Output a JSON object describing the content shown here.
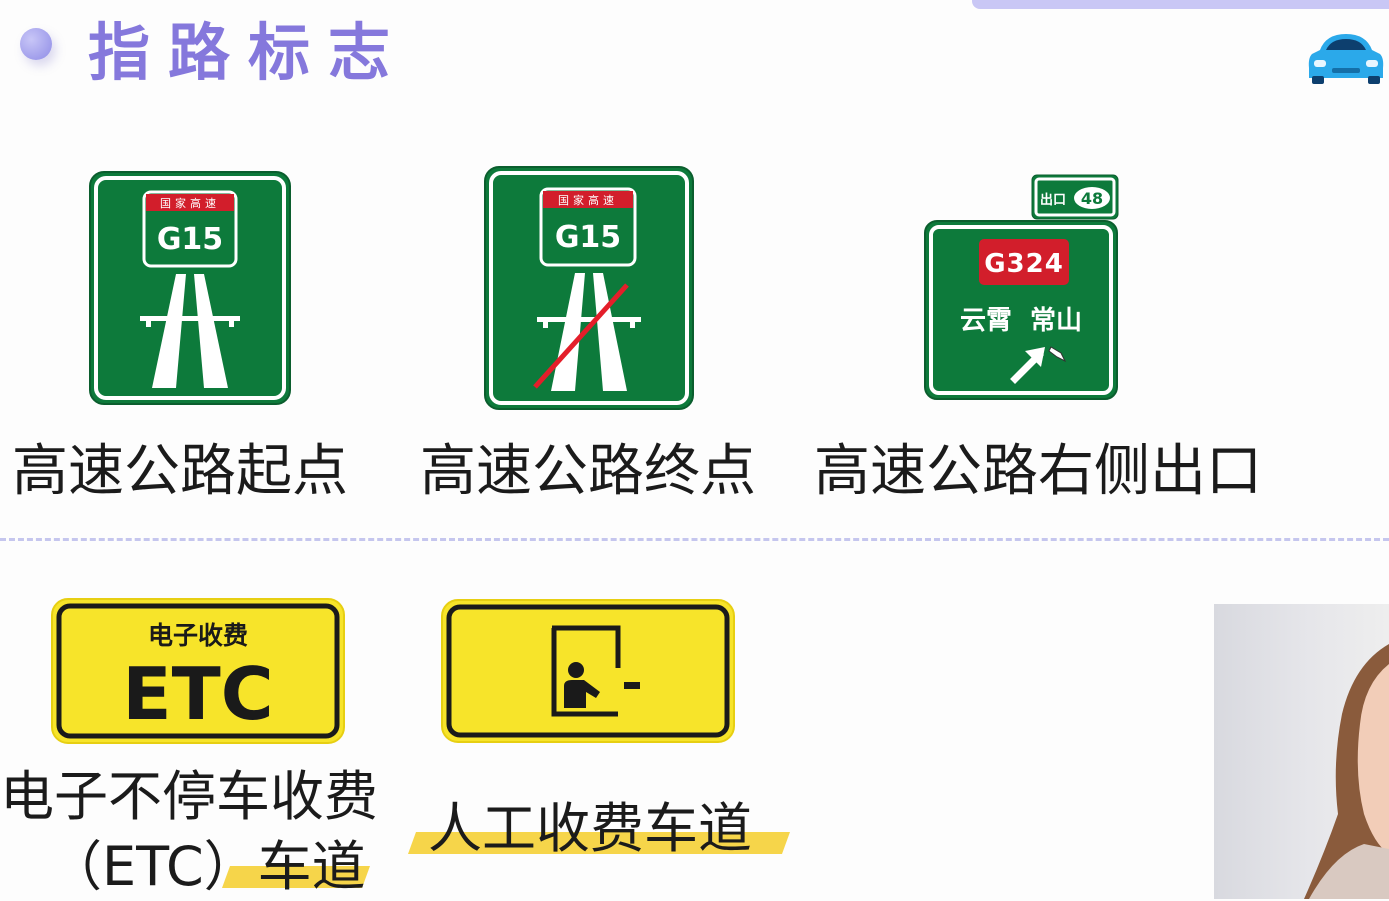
{
  "header": {
    "title": "指路标志"
  },
  "signs": {
    "start": {
      "shield_top": "国家高速",
      "route": "G15",
      "caption": "高速公路起点"
    },
    "end": {
      "shield_top": "国家高速",
      "route": "G15",
      "caption": "高速公路终点"
    },
    "exit": {
      "exit_label": "出口",
      "exit_number": "48",
      "route": "G324",
      "destinations": "云霄  常山",
      "caption": "高速公路右侧出口"
    },
    "etc": {
      "top_text": "电子收费",
      "main_text": "ETC",
      "caption_line1": "电子不停车收费",
      "caption_line2": "（ETC）车道"
    },
    "manual": {
      "caption": "人工收费车道"
    }
  },
  "colors": {
    "sign_green": "#0d7a3b",
    "sign_yellow": "#f7e42a",
    "shield_red": "#d21e2b",
    "accent_purple": "#8578dc",
    "highlight": "#f6d54a"
  }
}
